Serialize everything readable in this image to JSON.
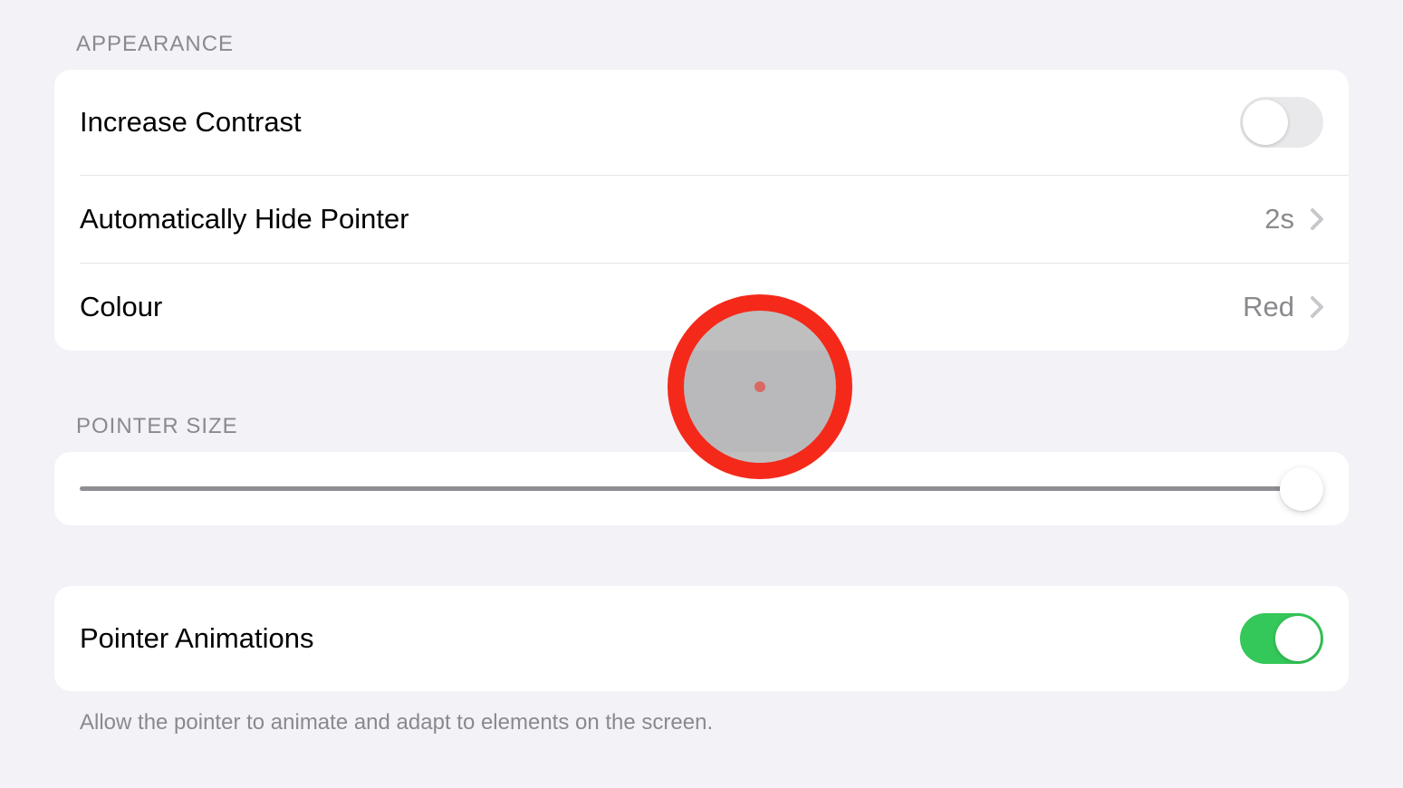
{
  "sections": {
    "appearance": {
      "header": "APPEARANCE",
      "rows": {
        "increase_contrast": {
          "label": "Increase Contrast",
          "toggle": false
        },
        "hide_pointer": {
          "label": "Automatically Hide Pointer",
          "value": "2s"
        },
        "colour": {
          "label": "Colour",
          "value": "Red"
        }
      }
    },
    "pointer_size": {
      "header": "POINTER SIZE",
      "slider_value": 100
    },
    "animations": {
      "rows": {
        "pointer_animations": {
          "label": "Pointer Animations",
          "toggle": true
        }
      },
      "footer": "Allow the pointer to animate and adapt to elements on the screen."
    }
  }
}
